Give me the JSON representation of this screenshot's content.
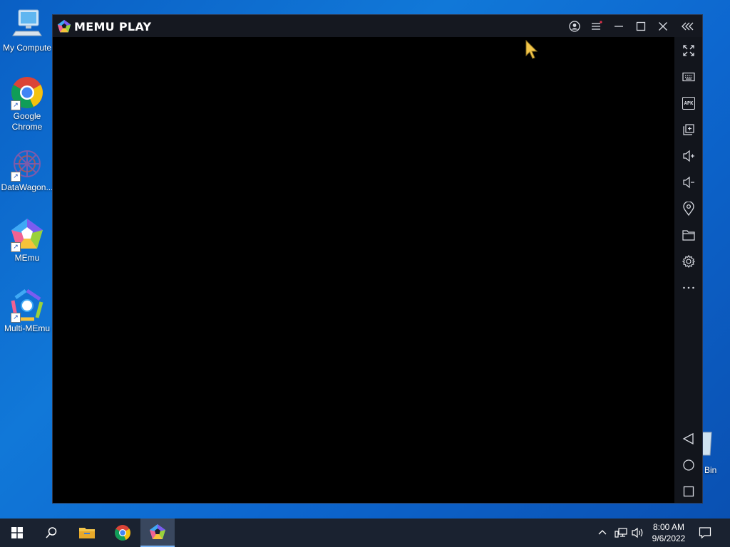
{
  "desktop": {
    "icons": [
      {
        "label": "My Compute"
      },
      {
        "label": "Google Chrome"
      },
      {
        "label": "DataWagon..."
      },
      {
        "label": "MEmu"
      },
      {
        "label": "Multi-MEmu"
      }
    ],
    "recycle_bin_label": "Bin"
  },
  "window": {
    "app_name": "MEMU PLAY",
    "titlebar_buttons": [
      "account-icon",
      "menu-icon",
      "minimize-icon",
      "maximize-icon",
      "close-icon",
      "collapse-toolbar-icon"
    ],
    "sidebar_buttons": [
      "fullscreen-icon",
      "keyboard-icon",
      "apk-install-icon",
      "multi-window-icon",
      "volume-up-icon",
      "volume-down-icon",
      "location-icon",
      "folder-icon",
      "settings-icon",
      "more-icon"
    ],
    "apk_label": "APK",
    "nav_buttons": [
      "back-icon",
      "home-icon",
      "recents-icon"
    ],
    "accent_color": "#e0314a"
  },
  "taskbar": {
    "buttons": [
      "windows-start-icon",
      "search-icon",
      "file-explorer-icon",
      "chrome-icon",
      "memu-icon"
    ],
    "clock": {
      "time": "8:00 AM",
      "date": "9/6/2022"
    }
  }
}
